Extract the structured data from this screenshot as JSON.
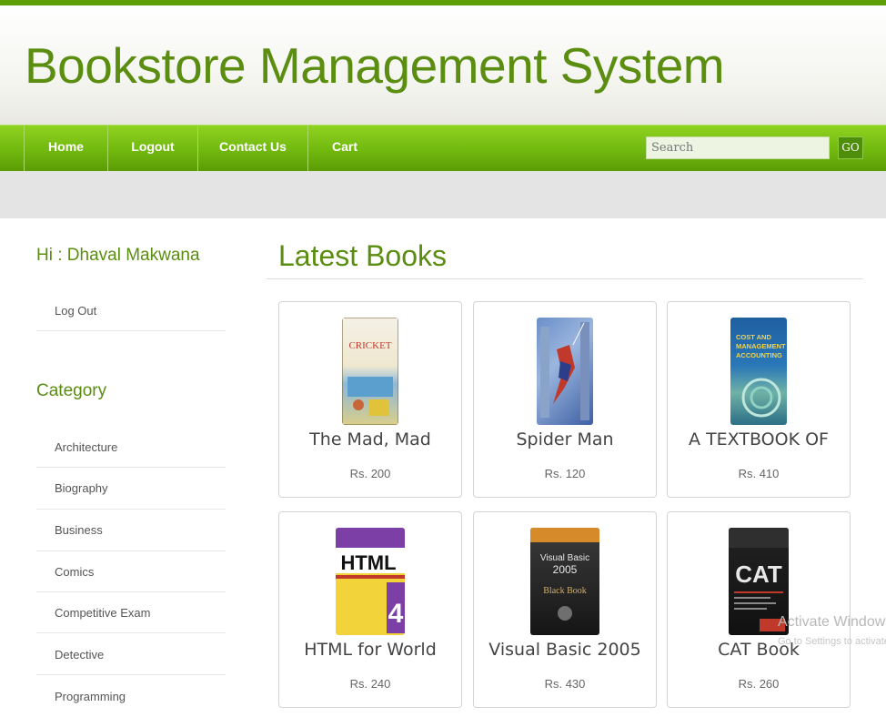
{
  "header": {
    "title": "Bookstore Management System"
  },
  "nav": {
    "items": [
      {
        "label": "Home"
      },
      {
        "label": "Logout"
      },
      {
        "label": "Contact Us"
      },
      {
        "label": "Cart"
      }
    ],
    "search_placeholder": "Search",
    "go_label": "GO"
  },
  "sidebar": {
    "greeting": "Hi : Dhaval Makwana",
    "logout_label": "Log Out",
    "category_title": "Category",
    "categories": [
      {
        "label": "Architecture"
      },
      {
        "label": "Biography"
      },
      {
        "label": "Business"
      },
      {
        "label": "Comics"
      },
      {
        "label": "Competitive Exam"
      },
      {
        "label": "Detective"
      },
      {
        "label": "Programming"
      }
    ]
  },
  "main": {
    "title": "Latest Books",
    "books": [
      {
        "title": "The Mad, Mad",
        "price": "Rs. 200",
        "cover_icon": "cricket-book-cover",
        "cover_text": "CRICKET"
      },
      {
        "title": "Spider Man",
        "price": "Rs. 120",
        "cover_icon": "spiderman-book-cover",
        "cover_text": ""
      },
      {
        "title": "A TEXTBOOK OF",
        "price": "Rs. 410",
        "cover_icon": "accounting-book-cover",
        "cover_text": "COST AND MANAGEMENT ACCOUNTING"
      },
      {
        "title": "HTML for World",
        "price": "Rs. 240",
        "cover_icon": "html-book-cover",
        "cover_text": "HTML"
      },
      {
        "title": "Visual Basic 2005",
        "price": "Rs. 430",
        "cover_icon": "visual-basic-book-cover",
        "cover_text": "Visual Basic 2005"
      },
      {
        "title": "CAT Book",
        "price": "Rs. 260",
        "cover_icon": "cat-book-cover",
        "cover_text": "CAT"
      }
    ]
  },
  "watermark": {
    "line1": "Activate Windows",
    "line2": "Go to Settings to activate"
  },
  "colors": {
    "accent_green": "#5a8d10",
    "nav_green": "#71b80f"
  }
}
